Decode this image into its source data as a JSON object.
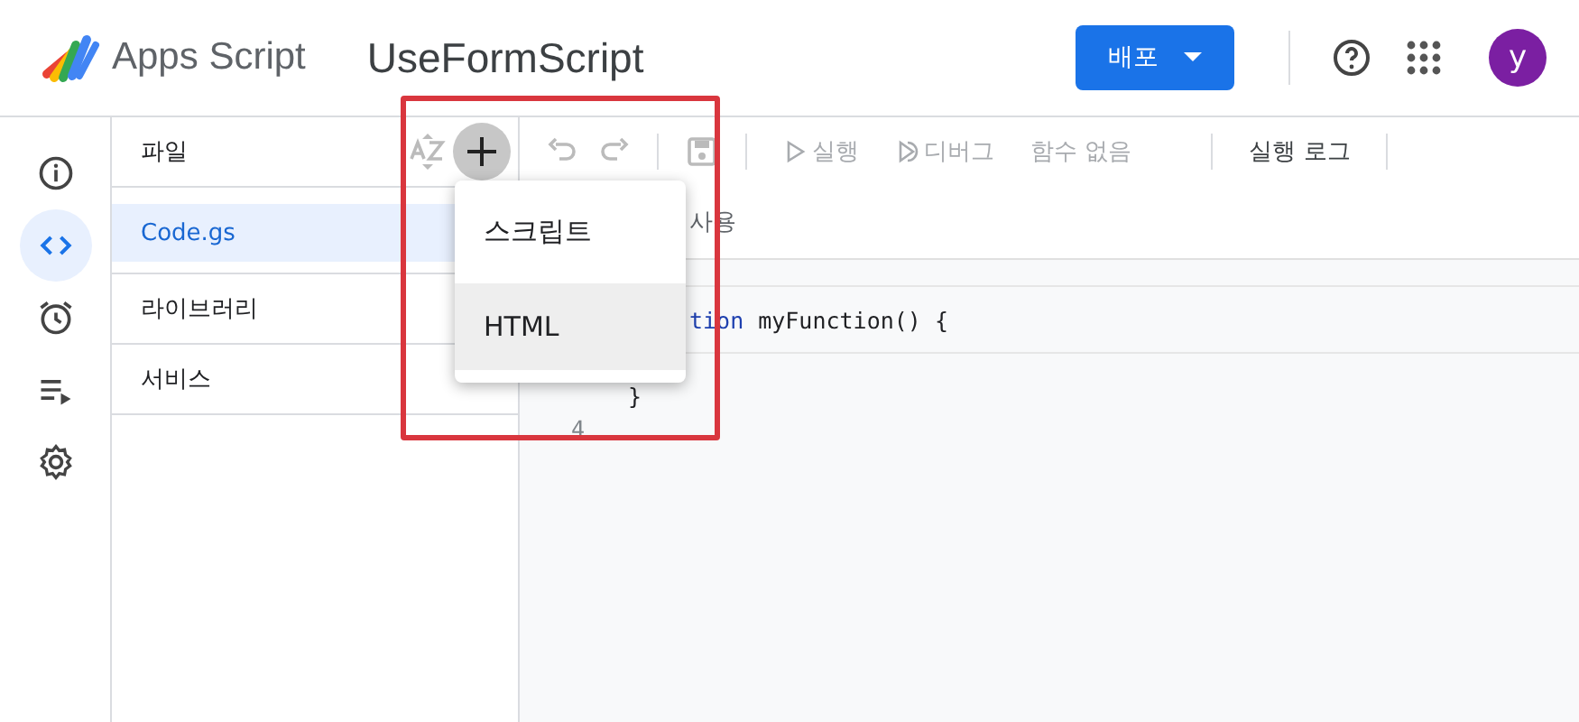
{
  "header": {
    "product": "Apps Script",
    "project": "UseFormScript",
    "deploy_button": "배포",
    "avatar": "y"
  },
  "rail": [
    {
      "selected": false
    },
    {
      "selected": true
    },
    {
      "selected": false
    },
    {
      "selected": false
    },
    {
      "selected": false
    }
  ],
  "files_panel": {
    "title": "파일",
    "items": [
      {
        "label": "Code.gs",
        "selected": true
      },
      {
        "label": "라이브러리",
        "selected": false
      },
      {
        "label": "서비스",
        "selected": false
      }
    ]
  },
  "toolbar": [
    {
      "kind": "run",
      "label": "실행",
      "disabled": true
    },
    {
      "kind": "debug",
      "label": "디버그",
      "disabled": true
    },
    {
      "kind": "select",
      "label": "함수 없음",
      "disabled": true
    },
    {
      "kind": "log",
      "label": "실행 로그",
      "disabled": false
    }
  ],
  "editor": {
    "tab_fragment": "사용",
    "lines": [
      {
        "keyword": "tion",
        "code": "myFunction() {"
      },
      {
        "code": "}"
      },
      {
        "number": "4"
      }
    ]
  },
  "menu": {
    "items": [
      {
        "label": "스크립트",
        "selected": false
      },
      {
        "label": "HTML",
        "selected": true
      }
    ]
  }
}
